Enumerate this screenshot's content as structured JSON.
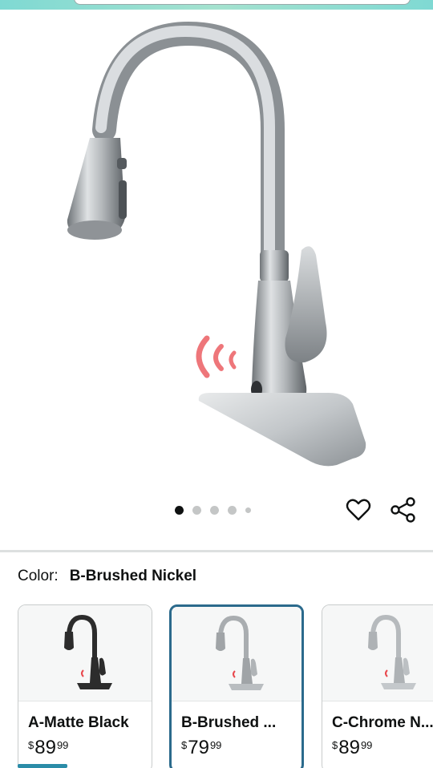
{
  "product": {
    "carousel": {
      "total": 5,
      "active_index": 0
    }
  },
  "color": {
    "label": "Color:",
    "selected": "B-Brushed Nickel"
  },
  "swatches": [
    {
      "name": "A-Matte Black",
      "currency": "$",
      "dollars": "89",
      "cents": "99",
      "finish": "#2c2c2c"
    },
    {
      "name": "B-Brushed ...",
      "currency": "$",
      "dollars": "79",
      "cents": "99",
      "finish": "#a9adb0"
    },
    {
      "name": "C-Chrome N...",
      "currency": "$",
      "dollars": "89",
      "cents": "99",
      "finish": "#b6babd"
    }
  ],
  "icons": {
    "wishlist": "heart-icon",
    "share": "share-icon"
  },
  "colors": {
    "selected_border": "#2b6a8c",
    "sensor_waves": "#e8484d"
  }
}
